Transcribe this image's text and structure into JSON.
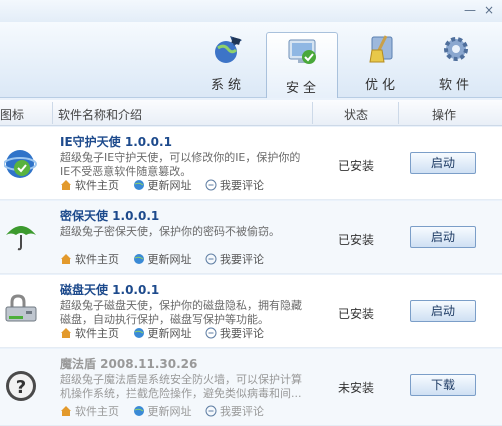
{
  "window": {
    "minimize_glyph": "—",
    "close_glyph": "×"
  },
  "toolbar": {
    "tabs": [
      {
        "label": "系统",
        "icon": "globe-icon"
      },
      {
        "label": "安全",
        "icon": "shield-monitor-icon",
        "selected": true
      },
      {
        "label": "优化",
        "icon": "broom-icon"
      },
      {
        "label": "软件",
        "icon": "gear-icon"
      }
    ]
  },
  "list": {
    "headers": {
      "icon": "图标",
      "name": "软件名称和介绍",
      "status": "状态",
      "action": "操作"
    },
    "links": {
      "home": "软件主页",
      "update": "更新网址",
      "review": "我要评论"
    },
    "rows": [
      {
        "title": "IE守护天使 1.0.0.1",
        "desc": "超级兔子IE守护天使，可以修改你的IE，保护你的IE不受恶意软件随意篡改。",
        "status": "已安装",
        "action": "启动",
        "icon": "ie-shield-icon"
      },
      {
        "title": "密保天使 1.0.0.1",
        "desc": "超级兔子密保天使，保护你的密码不被偷窃。",
        "status": "已安装",
        "action": "启动",
        "icon": "umbrella-icon"
      },
      {
        "title": "磁盘天使 1.0.0.1",
        "desc": "超级兔子磁盘天使，保护你的磁盘隐私，拥有隐藏磁盘，自动执行保护，磁盘写保护等功能。",
        "status": "已安装",
        "action": "启动",
        "icon": "disk-lock-icon"
      },
      {
        "title": "魔法盾 2008.11.30.26",
        "desc": "超级兔子魔法盾是系统安全防火墙，可以保护计算机操作系统，拦截危险操作，避免类似病毒和间...",
        "status": "未安装",
        "action": "下载",
        "icon": "question-icon"
      }
    ]
  },
  "colors": {
    "title_blue": "#1d4a8c",
    "toolbar_bg": "#dbe8f6"
  }
}
